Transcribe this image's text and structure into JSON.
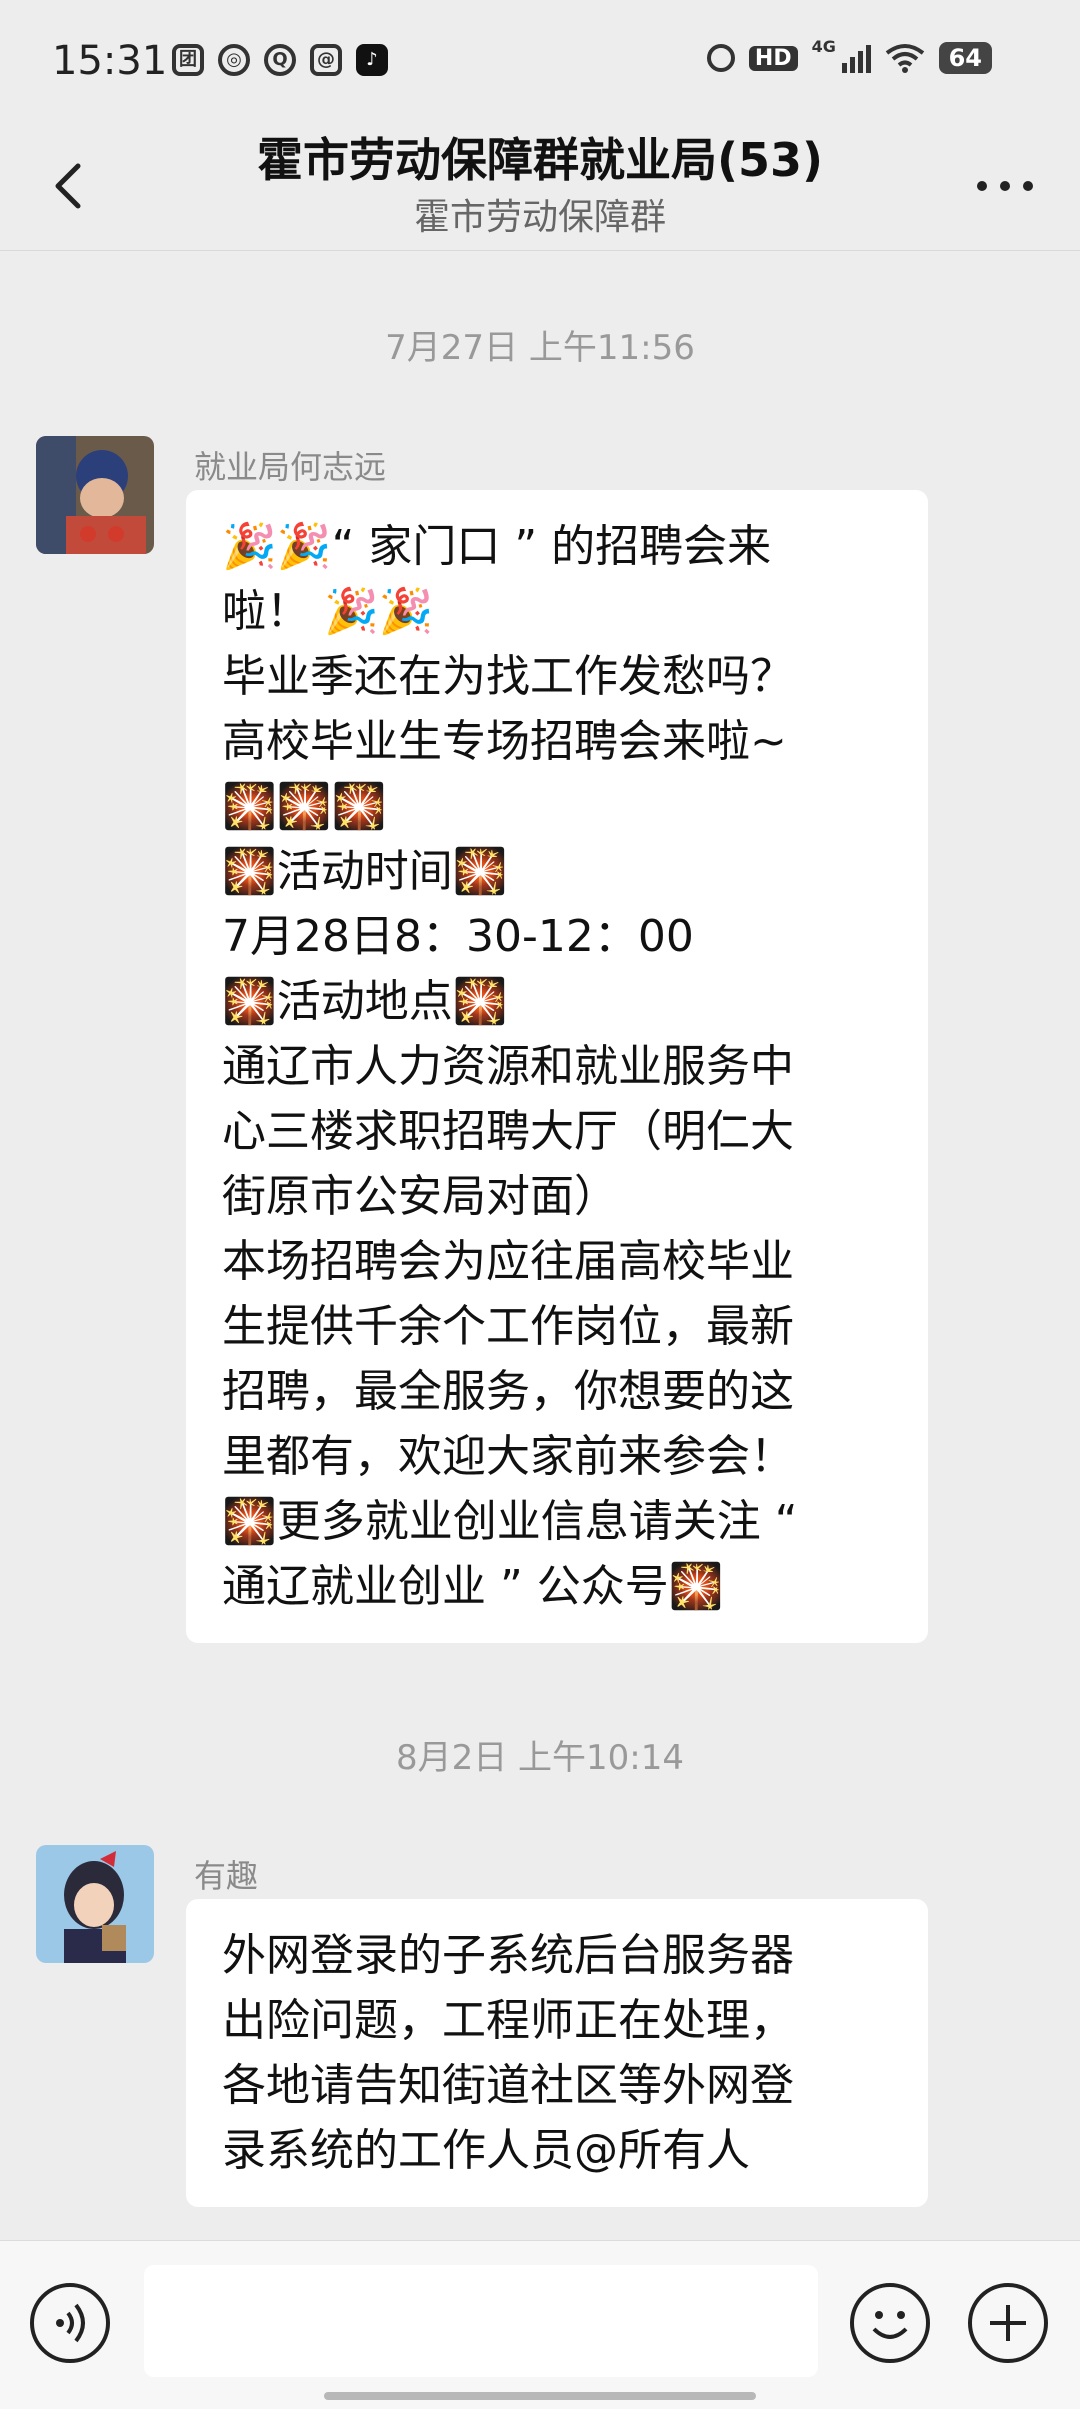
{
  "status_bar": {
    "time": "15:31",
    "battery": "64",
    "network": "4G",
    "hd": "HD",
    "notification_icons": [
      "团",
      "◎",
      "Q",
      "@",
      "♪"
    ]
  },
  "header": {
    "title": "霍市劳动保障群就业局(53)",
    "subtitle": "霍市劳动保障群"
  },
  "messages": [
    {
      "timestamp": "7月27日 上午11:56",
      "sender": "就业局何志远",
      "lines": [
        "🎉🎉“ 家门口 ” 的招聘会来",
        "啦！ 🎉🎉",
        "毕业季还在为找工作发愁吗？",
        "高校毕业生专场招聘会来啦~",
        "🎇🎇🎇",
        "🎇活动时间🎇",
        "7月28日8：30-12：00",
        "🎇活动地点🎇",
        "通辽市人力资源和就业服务中",
        "心三楼求职招聘大厅（明仁大",
        "街原市公安局对面）",
        "本场招聘会为应往届高校毕业",
        "生提供千余个工作岗位，最新",
        "招聘，最全服务，你想要的这",
        "里都有，欢迎大家前来参会！",
        "🎇更多就业创业信息请关注 “",
        "通辽就业创业 ” 公众号🎇"
      ]
    },
    {
      "timestamp": "8月2日 上午10:14",
      "sender": "有趣",
      "lines": [
        "外网登录的子系统后台服务器",
        "出险问题，工程师正在处理，",
        "各地请告知街道社区等外网登",
        "录系统的工作人员@所有人"
      ]
    }
  ],
  "input": {
    "placeholder": ""
  },
  "colors": {
    "background": "#ededed",
    "bubble": "#ffffff",
    "timestamp": "#999999"
  },
  "icons": [
    "back-icon",
    "more-icon",
    "voice-icon",
    "emoji-icon",
    "plus-icon",
    "alarm-icon",
    "wifi-icon",
    "battery-icon"
  ]
}
